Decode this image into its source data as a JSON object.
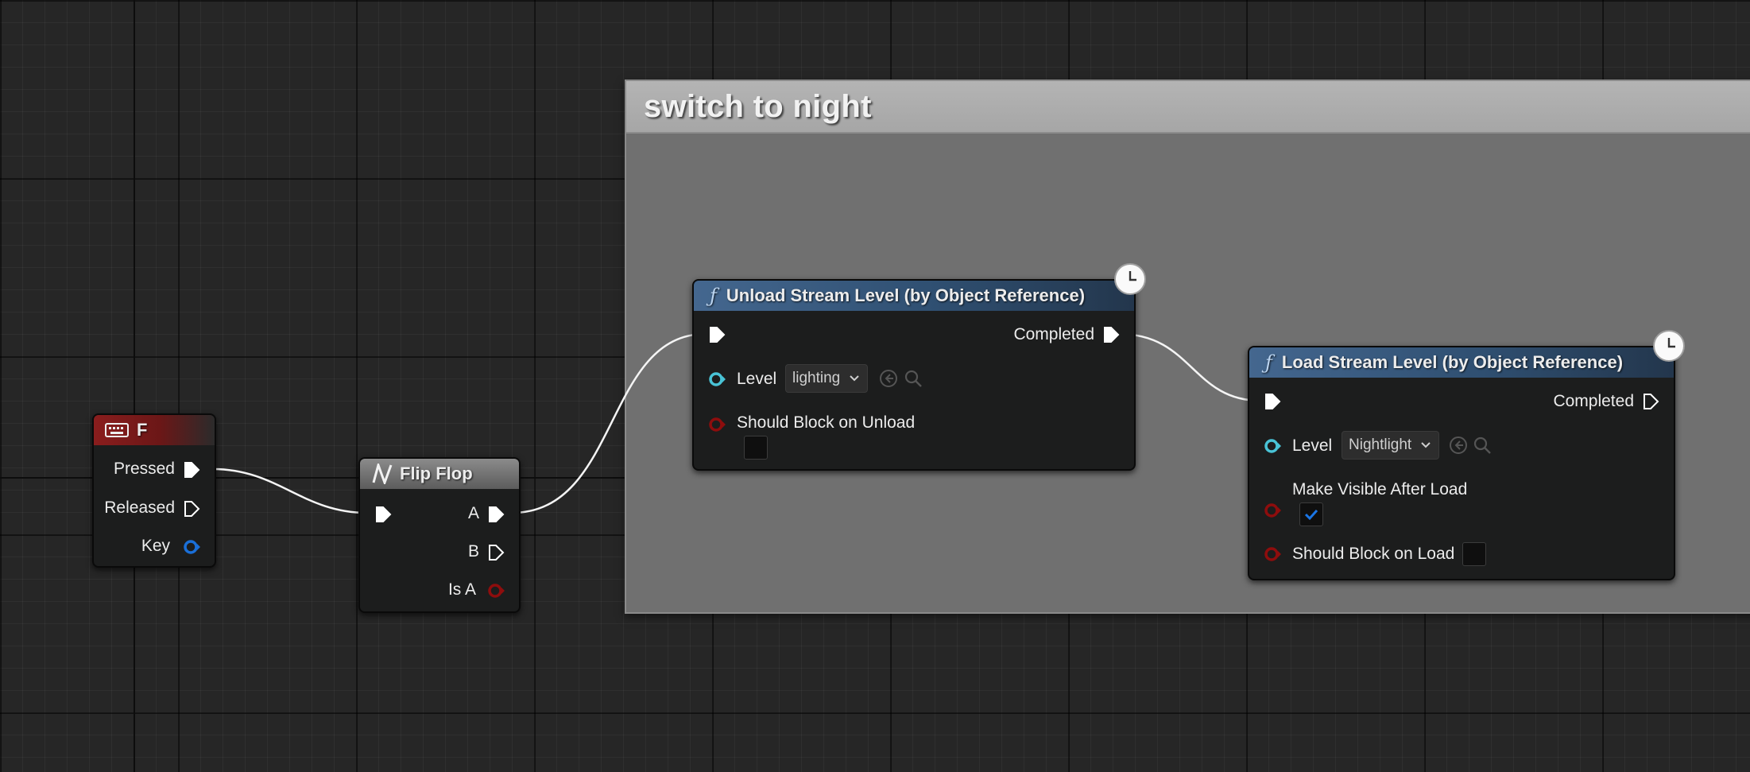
{
  "comment": {
    "title": "switch to night"
  },
  "nodes": {
    "key_event": {
      "title": "F",
      "pins": {
        "pressed": "Pressed",
        "released": "Released",
        "key": "Key"
      }
    },
    "flip_flop": {
      "title": "Flip Flop",
      "pins": {
        "a": "A",
        "b": "B",
        "is_a": "Is A"
      }
    },
    "unload": {
      "title": "Unload Stream Level (by Object Reference)",
      "completed": "Completed",
      "level_label": "Level",
      "level_value": "lighting",
      "should_block_label": "Should Block on Unload",
      "should_block_checked": false
    },
    "load": {
      "title": "Load Stream Level (by Object Reference)",
      "completed": "Completed",
      "level_label": "Level",
      "level_value": "Nightlight",
      "make_visible_label": "Make Visible After Load",
      "make_visible_checked": true,
      "should_block_label": "Should Block on Load",
      "should_block_checked": false
    }
  },
  "colors": {
    "exec_pin": "#ffffff",
    "object_pin": "#1a6fd8",
    "bool_pin": "#8e0d0d",
    "level_pin": "#49c3d6",
    "checkbox_check": "#1b76e6"
  },
  "icons": {
    "key_event": "keyboard-icon",
    "flip_flop": "flip-flop-icon",
    "function": "function-icon",
    "latent": "clock-icon",
    "browse": "browse-arrow-icon",
    "find": "search-icon",
    "dropdown": "chevron-down-icon"
  }
}
